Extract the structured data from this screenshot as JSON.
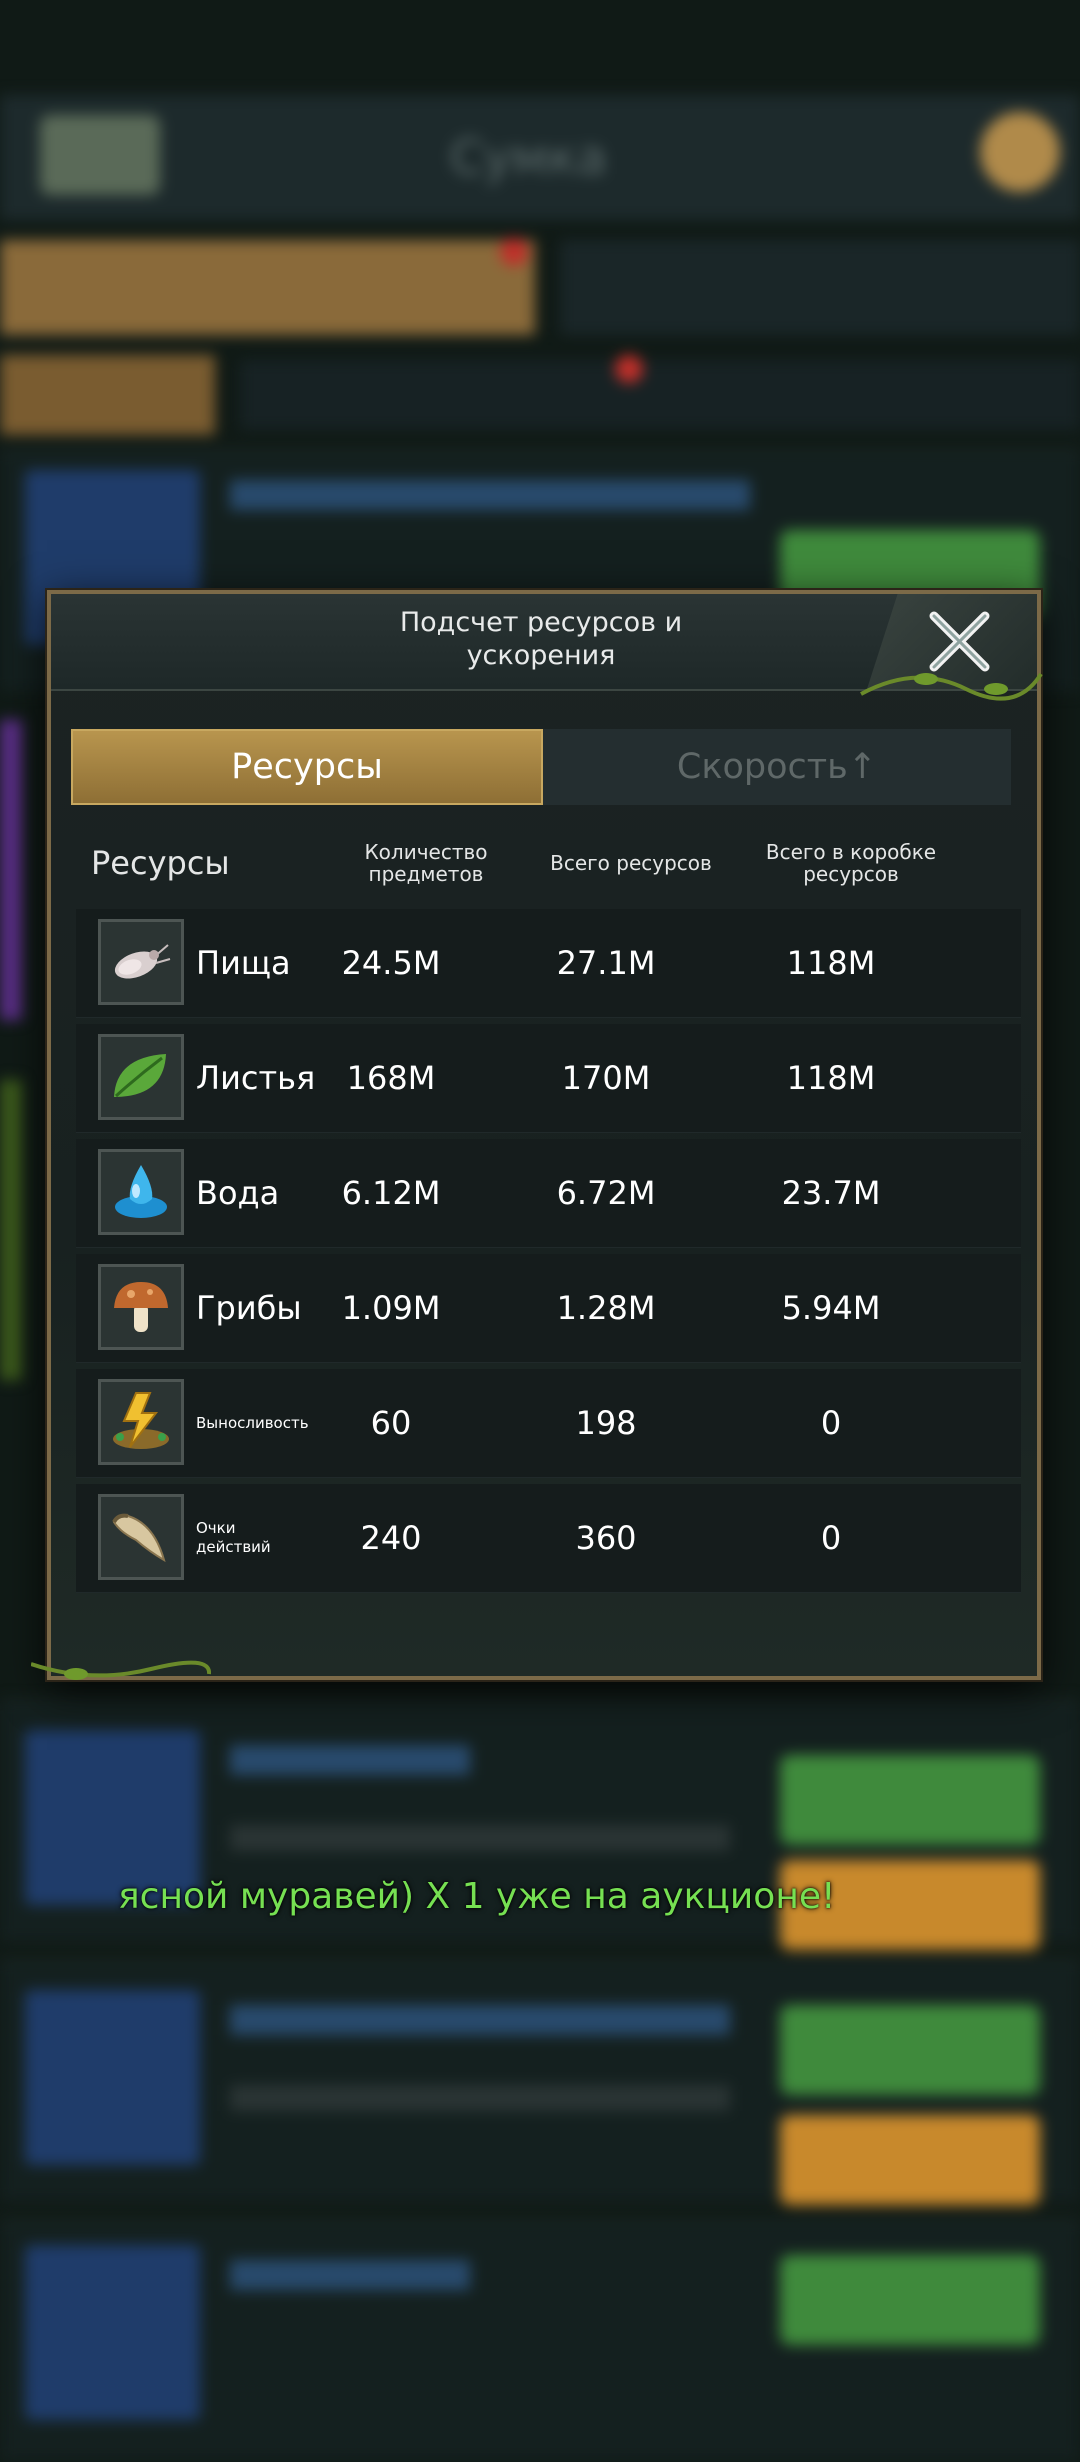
{
  "background": {
    "title": "Сумка"
  },
  "modal": {
    "title": "Подсчет ресурсов и ускорения",
    "tabs": [
      {
        "label": "Ресурсы",
        "active": true
      },
      {
        "label": "Скорость↑",
        "active": false
      }
    ],
    "columns": {
      "name": "Ресурсы",
      "items": "Количество предметов",
      "total": "Всего ресурсов",
      "box_total": "Всего в коробке ресурсов"
    },
    "rows": [
      {
        "name": "Пища",
        "icon": "food-icon",
        "items": "24.5M",
        "total": "27.1M",
        "box_total": "118M"
      },
      {
        "name": "Листья",
        "icon": "leaf-icon",
        "items": "168M",
        "total": "170M",
        "box_total": "118M"
      },
      {
        "name": "Вода",
        "icon": "water-drop-icon",
        "items": "6.12M",
        "total": "6.72M",
        "box_total": "23.7M"
      },
      {
        "name": "Грибы",
        "icon": "mushroom-icon",
        "items": "1.09M",
        "total": "1.28M",
        "box_total": "5.94M"
      },
      {
        "name": "Выносливость",
        "icon": "stamina-icon",
        "items": "60",
        "total": "198",
        "box_total": "0"
      },
      {
        "name": "Очки действий",
        "icon": "horn-icon",
        "items": "240",
        "total": "360",
        "box_total": "0"
      }
    ]
  },
  "notice": "ясной муравей) Х 1 уже на аукционе!",
  "colors": {
    "accent_gold": "#b8954e",
    "notice_green": "#76e052"
  }
}
